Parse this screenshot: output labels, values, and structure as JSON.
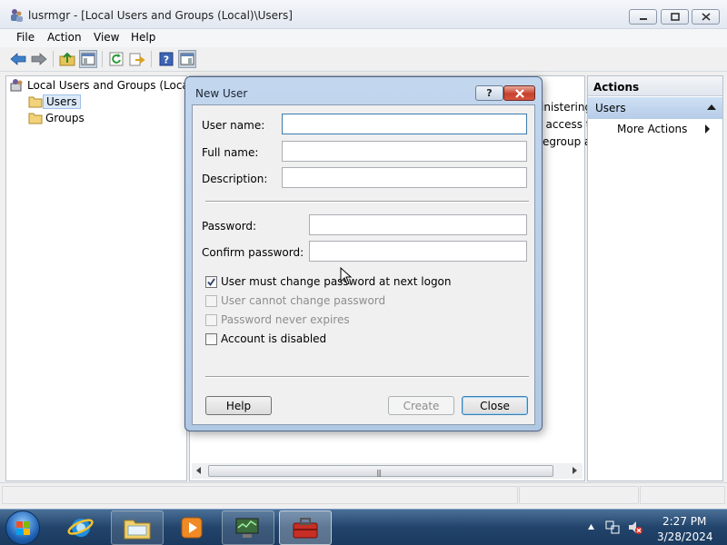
{
  "window": {
    "title": "lusrmgr - [Local Users and Groups (Local)\\Users]"
  },
  "menu": [
    "File",
    "Action",
    "View",
    "Help"
  ],
  "toolbar": {
    "icons": [
      "back-arrow-icon",
      "forward-arrow-icon",
      "up-folder-icon",
      "show-hide-tree-icon",
      "refresh-icon",
      "export-list-icon",
      "help-icon",
      "show-hide-action-pane-icon"
    ]
  },
  "tree": {
    "root": "Local Users and Groups (Local)",
    "children": [
      "Users",
      "Groups"
    ],
    "selected": "Users"
  },
  "list": {
    "snippets": [
      "inistering",
      "t access t",
      "egroup a"
    ]
  },
  "actions": {
    "header": "Actions",
    "section": "Users",
    "items": [
      "More Actions"
    ]
  },
  "dialog": {
    "title": "New User",
    "help_glyph": "?",
    "labels": {
      "username": "User name:",
      "fullname": "Full name:",
      "description": "Description:",
      "password": "Password:",
      "confirm": "Confirm password:"
    },
    "values": {
      "username": "",
      "fullname": "",
      "description": "",
      "password": "",
      "confirm": ""
    },
    "checkboxes": [
      {
        "label": "User must change password at next logon",
        "checked": true,
        "enabled": true
      },
      {
        "label": "User cannot change password",
        "checked": false,
        "enabled": false
      },
      {
        "label": "Password never expires",
        "checked": false,
        "enabled": false
      },
      {
        "label": "Account is disabled",
        "checked": false,
        "enabled": true
      }
    ],
    "buttons": {
      "help": "Help",
      "create": "Create",
      "close": "Close"
    }
  },
  "taskbar": {
    "items": [
      "start-button",
      "internet-explorer",
      "windows-explorer",
      "media-player",
      "computer-management",
      "lusrmgr-toolbox"
    ],
    "time": "2:27 PM",
    "date": "3/28/2024"
  }
}
